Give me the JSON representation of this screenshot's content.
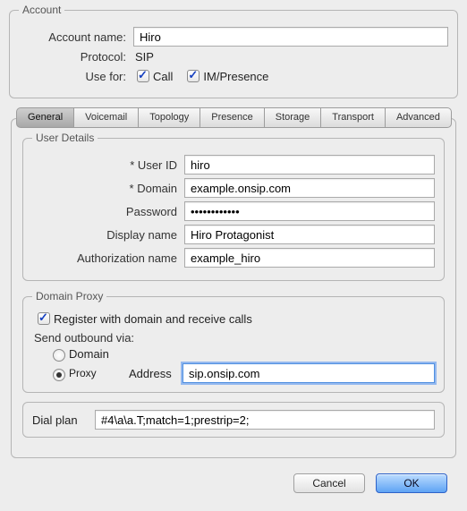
{
  "account": {
    "legend": "Account",
    "name_label": "Account name:",
    "name_value": "Hiro",
    "protocol_label": "Protocol:",
    "protocol_value": "SIP",
    "usefor_label": "Use for:",
    "call_label": "Call",
    "im_label": "IM/Presence",
    "call_checked": true,
    "im_checked": true
  },
  "tabs": [
    "General",
    "Voicemail",
    "Topology",
    "Presence",
    "Storage",
    "Transport",
    "Advanced"
  ],
  "selected_tab": 0,
  "user_details": {
    "legend": "User Details",
    "userid_label": "* User ID",
    "userid_value": "hiro",
    "domain_label": "* Domain",
    "domain_value": "example.onsip.com",
    "password_label": "Password",
    "password_value": "••••••••••••",
    "display_label": "Display name",
    "display_value": "Hiro Protagonist",
    "auth_label": "Authorization name",
    "auth_value": "example_hiro"
  },
  "proxy": {
    "legend": "Domain Proxy",
    "register_label": "Register with domain and receive calls",
    "register_checked": true,
    "sendvia_label": "Send outbound via:",
    "domain_label": "Domain",
    "proxy_label": "Proxy",
    "via": "proxy",
    "address_label": "Address",
    "address_value": "sip.onsip.com"
  },
  "dialplan": {
    "label": "Dial plan",
    "value": "#4\\a\\a.T;match=1;prestrip=2;"
  },
  "buttons": {
    "cancel": "Cancel",
    "ok": "OK"
  }
}
